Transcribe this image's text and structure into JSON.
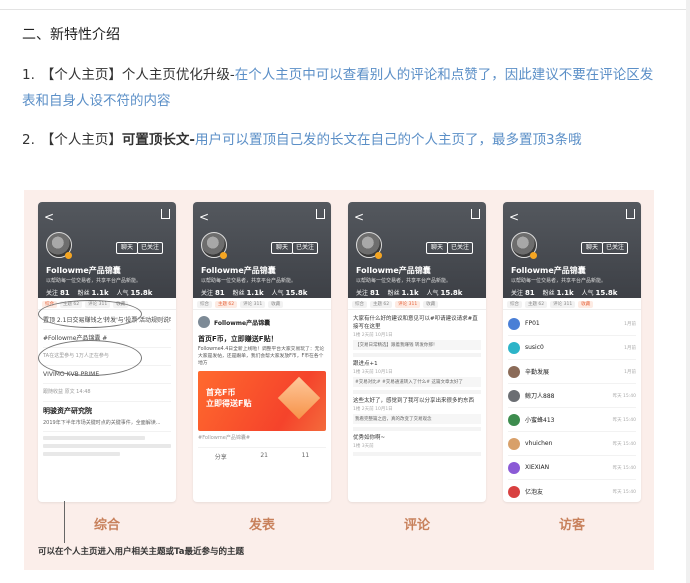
{
  "section": {
    "title": "二、新特性介绍"
  },
  "items": [
    {
      "num": "1.",
      "tag": "【个人主页】",
      "title": "个人主页优化升级-",
      "desc": "在个人主页中可以查看别人的评论和点赞了，因此建议不要在评论区发表和自身人设不符的内容"
    },
    {
      "num": "2.",
      "tag": "【个人主页】",
      "title": "可置顶长文-",
      "desc": "用户可以置顶自己发的长文在自己的个人主页了，最多置顶3条哦"
    }
  ],
  "figure": {
    "note": "可以在个人主页进入用户相关主题或Ta最近参与的主题",
    "profile": {
      "back": "<",
      "name": "Followme产品锦囊",
      "desc": "以帮助每一位交易者，共享平台产品新能。",
      "stats": [
        {
          "label": "关注",
          "value": "81"
        },
        {
          "label": "粉丝",
          "value": "1.1k"
        },
        {
          "label": "人气",
          "value": "15.8k"
        }
      ],
      "chat": "聊天",
      "follow": "已关注"
    },
    "tabs": [
      "综合",
      "主题 62",
      "评论 311",
      "收藏"
    ],
    "tabs_dim": [
      "综合",
      "主题 62",
      "评论 311",
      "收藏"
    ],
    "phones": [
      {
        "caption": "综合",
        "rows": [
          "置顶 2.1日交易赚钱之'转发'与'投票'活动规则说明",
          "#Followme产品锦囊 #",
          "TA在这里参与  1万人正在参与",
          "VIVIMO  KVB PRIME",
          "跟随收益  原文 14:48"
        ],
        "card_title": "明骏资产研究院",
        "card_text": "2019年下半年市场关键时点的关键事件，全面解读..."
      },
      {
        "caption": "发表",
        "user": "Followme产品锦囊",
        "title": "首页F币，立即赚送F贴！",
        "text": "Followme4.4日全新上线啦！调整平台大家交易玩了：无论大家是发帖，还是跟单，我们会帮大家发放F币，F币在各个地方",
        "banner": "首充F币\n立即得送F贴",
        "topic": "#Followme产品锦囊#",
        "actions": [
          "分享",
          "21",
          "11"
        ]
      },
      {
        "caption": "评论",
        "comments": [
          {
            "text": "大家有什么好的建议和意见可以#叩请建议请求#直接写在这里",
            "meta": "1楼  2天前  10月1日",
            "quote": "【交易日常精选】跟着我赚钱 转发你那！"
          },
          {
            "text": "跟进点+1",
            "meta": "1楼  3天前  10月1日",
            "quote": "#交易对比# #交易通道转入了什么# 这篇文章太好了"
          },
          {
            "text": "这些太好了，感觉到了我可以分享出来很多的东西",
            "meta": "1楼  2天前  10月1日",
            "quote": "我看完整篇之后，真的改变了交易观念"
          },
          {
            "text": "优秀如你啊~",
            "meta": "1楼  3天前",
            "quote": ""
          }
        ]
      },
      {
        "caption": "访客",
        "visitors": [
          {
            "name": "FP01",
            "time": "1月前",
            "color": "#4a7fd6"
          },
          {
            "name": "susic0",
            "time": "1月前",
            "color": "#2db4c8"
          },
          {
            "name": "辛勤发展",
            "time": "1月前",
            "color": "#8b6b58"
          },
          {
            "name": "鲸刀人888",
            "time": "昨天 15:40",
            "color": "#6b6e73"
          },
          {
            "name": "小蜜蜂413",
            "time": "昨天 15:40",
            "color": "#3d8c4e"
          },
          {
            "name": "vhuichen",
            "time": "昨天 15:40",
            "color": "#d8a06a"
          },
          {
            "name": "XIEXIAN",
            "time": "昨天 15:40",
            "color": "#8b5ad6"
          },
          {
            "name": "亿泡友",
            "time": "昨天 15:40",
            "color": "#d84040"
          }
        ]
      }
    ]
  }
}
